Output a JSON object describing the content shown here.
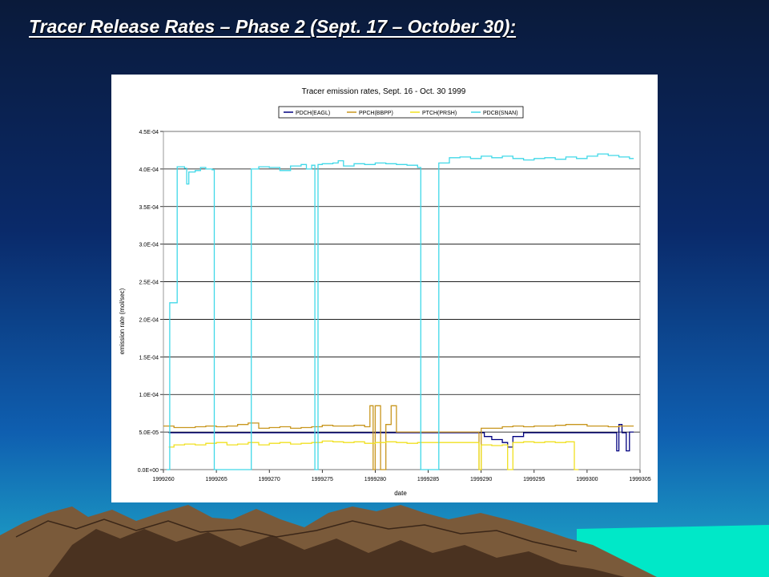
{
  "slide": {
    "title": "Tracer Release Rates – Phase 2 (Sept. 17 – October 30):"
  },
  "colors": {
    "background_top": "#0a1a3a",
    "background_bottom": "#1fa8c8",
    "mountain": "#7a5a3a",
    "mountain_shadow": "#4a3220",
    "sea": "#00e8c8",
    "gridline": "#000000"
  },
  "chart_data": {
    "type": "line",
    "title": "Tracer emission rates, Sept. 16 - Oct. 30 1999",
    "xlabel": "date",
    "ylabel": "emission rate (mol/sec)",
    "xlim": [
      1999260,
      1999305
    ],
    "ylim": [
      0,
      0.00045
    ],
    "x_ticks": [
      1999260,
      1999265,
      1999270,
      1999275,
      1999280,
      1999285,
      1999290,
      1999295,
      1999300,
      1999305
    ],
    "x_tick_labels": [
      "1999260",
      "1999265",
      "1999270",
      "1999275",
      "1999280",
      "1999285",
      "1999290",
      "1999295",
      "1999300",
      "1999305"
    ],
    "y_ticks": [
      0,
      5e-05,
      0.0001,
      0.00015,
      0.0002,
      0.00025,
      0.0003,
      0.00035,
      0.0004,
      0.00045
    ],
    "y_tick_labels": [
      "0.0E+00",
      "5.0E-05",
      "1.0E-04",
      "1.5E-04",
      "2.0E-04",
      "2.5E-04",
      "3.0E-04",
      "3.5E-04",
      "4.0E-04",
      "4.5E-04"
    ],
    "grid": "horizontal",
    "legend_position": "top",
    "series": [
      {
        "name": "PDCH(EAGL)",
        "color": "#000080",
        "x": [
          1999260.5,
          1999261,
          1999262,
          1999263,
          1999264,
          1999265,
          1999266,
          1999267,
          1999268,
          1999269,
          1999270,
          1999271,
          1999272,
          1999273,
          1999274,
          1999275,
          1999276,
          1999277,
          1999278,
          1999279,
          1999280,
          1999281,
          1999282,
          1999283,
          1999284,
          1999285,
          1999286,
          1999287,
          1999288,
          1999289,
          1999290,
          1999290.3,
          1999291,
          1999292,
          1999292.5,
          1999293,
          1999294,
          1999295,
          1999296,
          1999297,
          1999298,
          1999299,
          1999300,
          1999301,
          1999302,
          1999302.5,
          1999302.8,
          1999303,
          1999303.3,
          1999303.6,
          1999303.7,
          1999304
        ],
        "y": [
          4.9e-05,
          4.9e-05,
          4.9e-05,
          4.9e-05,
          4.9e-05,
          4.9e-05,
          4.9e-05,
          4.9e-05,
          4.9e-05,
          4.9e-05,
          4.9e-05,
          4.9e-05,
          4.9e-05,
          4.9e-05,
          4.9e-05,
          4.9e-05,
          4.9e-05,
          4.9e-05,
          4.9e-05,
          4.9e-05,
          4.9e-05,
          4.9e-05,
          4.9e-05,
          4.9e-05,
          4.9e-05,
          4.9e-05,
          4.9e-05,
          4.9e-05,
          4.9e-05,
          4.9e-05,
          4.9e-05,
          4.4e-05,
          4e-05,
          3.6e-05,
          3e-05,
          4.4e-05,
          4.9e-05,
          4.9e-05,
          4.9e-05,
          4.9e-05,
          4.9e-05,
          4.9e-05,
          4.9e-05,
          4.9e-05,
          4.9e-05,
          4.9e-05,
          2.5e-05,
          6e-05,
          4.9e-05,
          4.9e-05,
          2.5e-05,
          5e-05
        ]
      },
      {
        "name": "PPCH(BBPP)",
        "color": "#c8961e",
        "x": [
          1999260,
          1999261,
          1999262,
          1999263,
          1999264,
          1999265,
          1999266,
          1999267,
          1999268,
          1999269,
          1999270,
          1999271,
          1999272,
          1999273,
          1999274,
          1999275,
          1999276,
          1999277,
          1999278,
          1999279,
          1999279.5,
          1999279.8,
          1999280,
          1999280.5,
          1999281,
          1999281.5,
          1999282,
          1999283,
          1999284,
          1999285,
          1999286,
          1999287,
          1999288,
          1999289,
          1999289.8,
          1999290,
          1999291,
          1999292,
          1999293,
          1999294,
          1999295,
          1999296,
          1999297,
          1999298,
          1999299,
          1999300,
          1999301,
          1999302,
          1999303,
          1999304
        ],
        "y": [
          5.8e-05,
          5.6e-05,
          5.6e-05,
          5.7e-05,
          5.8e-05,
          5.7e-05,
          5.8e-05,
          6e-05,
          6.2e-05,
          5.5e-05,
          5.6e-05,
          5.7e-05,
          5.5e-05,
          5.6e-05,
          5.7e-05,
          5.9e-05,
          5.8e-05,
          5.8e-05,
          5.9e-05,
          5.7e-05,
          8.5e-05,
          0.0,
          8.5e-05,
          0.0,
          6e-05,
          8.5e-05,
          5e-05,
          5e-05,
          5e-05,
          5e-05,
          5e-05,
          5e-05,
          5e-05,
          5e-05,
          0.0,
          5.5e-05,
          5.5e-05,
          5.7e-05,
          5.8e-05,
          5.7e-05,
          5.8e-05,
          5.8e-05,
          5.9e-05,
          6e-05,
          6e-05,
          5.8e-05,
          5.8e-05,
          5.7e-05,
          5.8e-05,
          5.8e-05
        ]
      },
      {
        "name": "PTCH(PRSH)",
        "color": "#f0e020",
        "x": [
          1999260.5,
          1999261,
          1999262,
          1999263,
          1999264,
          1999265,
          1999266,
          1999267,
          1999268,
          1999269,
          1999270,
          1999271,
          1999272,
          1999273,
          1999274,
          1999275,
          1999276,
          1999277,
          1999278,
          1999279,
          1999280,
          1999281,
          1999282,
          1999283,
          1999284,
          1999285,
          1999286,
          1999287,
          1999288,
          1999289,
          1999289.8,
          1999290,
          1999291,
          1999292,
          1999292.5,
          1999293,
          1999294,
          1999295,
          1999296,
          1999297,
          1999298,
          1999298.8
        ],
        "y": [
          3e-05,
          3.3e-05,
          3.4e-05,
          3.3e-05,
          3.5e-05,
          3.6e-05,
          3.3e-05,
          3.4e-05,
          3.6e-05,
          3.3e-05,
          3.5e-05,
          3.6e-05,
          3.4e-05,
          3.5e-05,
          3.6e-05,
          3.8e-05,
          3.7e-05,
          3.6e-05,
          3.7e-05,
          3.5e-05,
          3.6e-05,
          3.7e-05,
          3.6e-05,
          3.5e-05,
          3.6e-05,
          3.6e-05,
          3.6e-05,
          3.6e-05,
          3.6e-05,
          3.6e-05,
          0.0,
          3.3e-05,
          3.2e-05,
          3.3e-05,
          0.0,
          3.6e-05,
          3.7e-05,
          3.6e-05,
          3.7e-05,
          3.6e-05,
          3.7e-05,
          0.0
        ]
      },
      {
        "name": "PDCB(SNAN)",
        "color": "#40d8e8",
        "x": [
          1999260.3,
          1999260.6,
          1999261,
          1999261.3,
          1999262,
          1999262.2,
          1999262.4,
          1999263,
          1999263.5,
          1999264,
          1999264.6,
          1999264.8,
          1999268,
          1999268.3,
          1999269,
          1999270,
          1999271,
          1999272,
          1999273,
          1999273.5,
          1999274,
          1999274.3,
          1999274.6,
          1999275,
          1999276,
          1999276.5,
          1999277,
          1999278,
          1999279,
          1999280,
          1999281,
          1999282,
          1999283,
          1999284,
          1999284.3,
          1999285,
          1999285.8,
          1999286,
          1999287,
          1999288,
          1999289,
          1999290,
          1999291,
          1999292,
          1999293,
          1999294,
          1999295,
          1999296,
          1999297,
          1999298,
          1999299,
          1999300,
          1999301,
          1999302,
          1999303,
          1999304
        ],
        "y": [
          0.0,
          0.000222,
          0.000222,
          0.000403,
          0.000401,
          0.00038,
          0.000396,
          0.000398,
          0.000402,
          0.0004,
          0.000399,
          0.0,
          0.0,
          0.0004,
          0.000403,
          0.000402,
          0.000398,
          0.000404,
          0.000406,
          0.0004,
          0.000405,
          0.0,
          0.000406,
          0.000407,
          0.000408,
          0.000411,
          0.000404,
          0.000407,
          0.000406,
          0.000408,
          0.000407,
          0.000406,
          0.000405,
          0.000402,
          0.0,
          0.0,
          0.0,
          0.000408,
          0.000415,
          0.000416,
          0.000414,
          0.000417,
          0.000415,
          0.000417,
          0.000414,
          0.000412,
          0.000414,
          0.000415,
          0.000413,
          0.000416,
          0.000414,
          0.000417,
          0.00042,
          0.000418,
          0.000416,
          0.000414
        ]
      }
    ]
  }
}
